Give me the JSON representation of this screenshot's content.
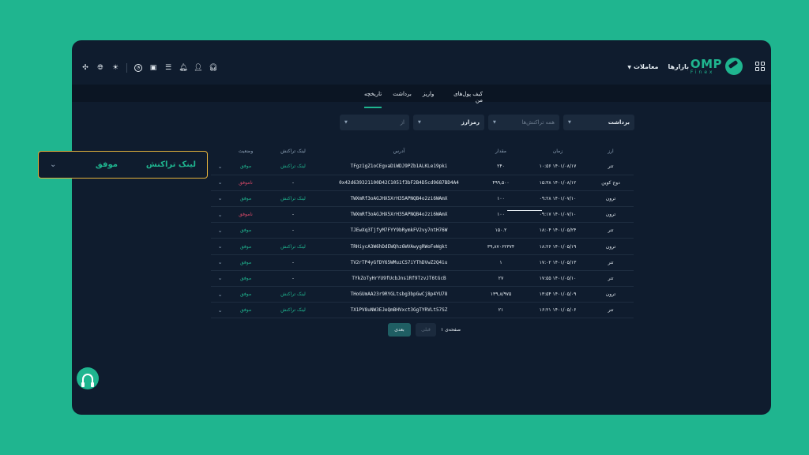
{
  "brand": {
    "name": "OMP",
    "sub": "Finex"
  },
  "nav": {
    "markets": "بازارها",
    "trades": "معاملات"
  },
  "tabs": [
    {
      "label": "کیف پول‌های من",
      "active": false
    },
    {
      "label": "واریز",
      "active": false
    },
    {
      "label": "برداشت",
      "active": false
    },
    {
      "label": "تاریخچه",
      "active": true
    }
  ],
  "filters": {
    "type": "برداشت",
    "transactions": "همه تراکنش‌ها",
    "currency": "رمزارز",
    "from": "از"
  },
  "table": {
    "headers": [
      "ارز",
      "زمان",
      "مقدار",
      "آدرس",
      "لینک تراکنش",
      "وضعیت"
    ],
    "rows": [
      {
        "arz": "تتر",
        "time": "۱۴۰۱/۰۸/۱۷ ۱۰:۵۶",
        "amount": "۲۴۰",
        "address": "TFgz1gZ1oCEgvaDiWDJ9PZb1ALKLe19pki",
        "link": "لینک تراکنش",
        "status": "موفق",
        "status_type": "ok"
      },
      {
        "arz": "دوج کوین",
        "time": "۱۴۰۱/۰۸/۱۲ ۱۵:۳۸",
        "amount": "۴۹۹,۵۰۰",
        "address": "0x42d639321100D42C1051f3bF2B4D5cd9687BD4A4",
        "link": "-",
        "status": "ناموفق",
        "status_type": "fail"
      },
      {
        "arz": "ترون",
        "time": "۱۴۰۱/۰۷/۱۰ ۰۹:۲۸",
        "amount": "۱۰۰",
        "address": "TWXmRf3oAGJHX5XrH35APNQB4o2zi6WAmX",
        "link": "لینک تراکنش",
        "status": "موفق",
        "status_type": "ok"
      },
      {
        "arz": "ترون",
        "time": "۱۴۰۱/۰۷/۱۰ ۰۹:۱۷",
        "amount": "۱۰۰",
        "address": "TWXmRf3oAGJHX5XrH35APNQB4o2zi6WAmX",
        "link": "-",
        "status": "ناموفق",
        "status_type": "fail"
      },
      {
        "arz": "تتر",
        "time": "۱۴۰۱/۰۵/۲۴ ۱۸:۰۴",
        "amount": "۱۵۰.۲",
        "address": "TJEwXq3TjfyM7FYY9bRymkFV2vy7ntH76W",
        "link": "-",
        "status": "موفق",
        "status_type": "ok"
      },
      {
        "arz": "ترون",
        "time": "۱۴۰۱/۰۵/۱۹ ۱۸:۲۶",
        "amount": "۳۹,۸۷۰۶۲۳۷۴",
        "address": "TRHiycA3W6hDdEWQhz6WVAwygRWoFeWgkt",
        "link": "لینک تراکنش",
        "status": "موفق",
        "status_type": "ok"
      },
      {
        "arz": "تتر",
        "time": "۱۴۰۱/۰۵/۱۳ ۱۷:۰۲",
        "amount": "۱",
        "address": "TV2rTP4yGfDY65WMuzCS7iYThDVwZ2Q4iu",
        "link": "-",
        "status": "موفق",
        "status_type": "ok"
      },
      {
        "arz": "تتر",
        "time": "۱۴۰۱/۰۵/۱۰ ۱۷:۵۵",
        "amount": "۲۷",
        "address": "TYkZoTyHrYU9fUcbJns1Rf9TzvJT6tGcB",
        "link": "-",
        "status": "موفق",
        "status_type": "ok"
      },
      {
        "arz": "ترون",
        "time": "۱۴۰۱/۰۵/۰۹ ۱۳:۵۴",
        "amount": "۱۳۹,۸/۹۷۵",
        "address": "THoGUmAA23r9RYGLtsbg3bpGwCj8p4YU78",
        "link": "لینک تراکنش",
        "status": "موفق",
        "status_type": "ok"
      },
      {
        "arz": "تتر",
        "time": "۱۴۰۱/۰۵/۰۶ ۱۶:۲۱",
        "amount": "۲۱",
        "address": "TX1PV8uNW3EJeQmBHVxct3GgTYRVLt57SZ",
        "link": "لینک تراکنش",
        "status": "موفق",
        "status_type": "ok"
      }
    ]
  },
  "pagination": {
    "page_label": "صفحه‌ی ۱",
    "prev": "قبلی",
    "next": "بعدی"
  },
  "zoom": {
    "link": "لینک تراکنش",
    "status": "موفق"
  },
  "colors": {
    "accent": "#1fb58f",
    "fail": "#e04a6a",
    "highlight": "#e3b23c",
    "bg": "#0f1c2e"
  }
}
